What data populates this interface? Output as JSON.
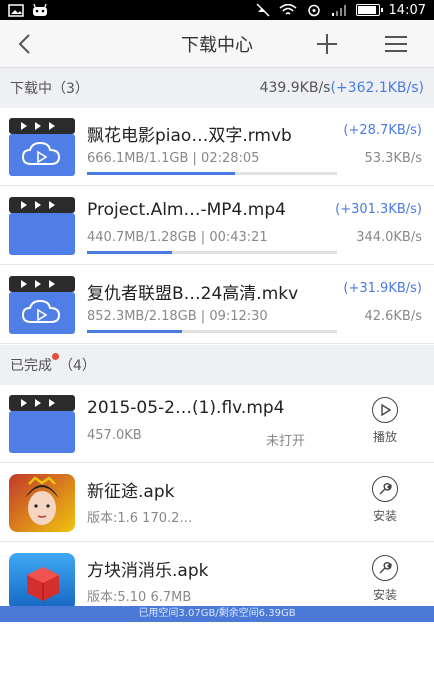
{
  "statusbar": {
    "time": "14:07"
  },
  "header": {
    "title": "下载中心"
  },
  "downloading": {
    "label": "下载中（3）",
    "total_speed": "439.9KB/s",
    "total_delta": "(+362.1KB/s)",
    "items": [
      {
        "name": "飘花电影piao…双字.rmvb",
        "delta": "(+28.7KB/s)",
        "meta": "666.1MB/1.1GB | 02:28:05",
        "rate": "53.3KB/s",
        "progress": 0.59,
        "thumb": "video-cloud"
      },
      {
        "name": "Project.Alm…-MP4.mp4",
        "delta": "(+301.3KB/s)",
        "meta": "440.7MB/1.28GB | 00:43:21",
        "rate": "344.0KB/s",
        "progress": 0.34,
        "thumb": "video-plain"
      },
      {
        "name": "复仇者联盟B…24高清.mkv",
        "delta": "(+31.9KB/s)",
        "meta": "852.3MB/2.18GB | 09:12:30",
        "rate": "42.6KB/s",
        "progress": 0.38,
        "thumb": "video-cloud"
      }
    ]
  },
  "completed": {
    "label": "已完成",
    "count": "（4）",
    "items": [
      {
        "name": "2015-05-2…(1).flv.mp4",
        "meta": "457.0KB",
        "status": "未打开",
        "action": "播放",
        "action_icon": "play-icon"
      },
      {
        "name": "新征途.apk",
        "meta": "版本:1.6    170.2…",
        "action": "安装",
        "action_icon": "wrench-icon"
      },
      {
        "name": "方块消消乐.apk",
        "meta": "版本:5.10    6.7MB",
        "action": "安装",
        "action_icon": "wrench-icon"
      }
    ]
  },
  "storage": {
    "text": "已用空间3.07GB/剩余空间6.39GB"
  },
  "colors": {
    "accent": "#4a7be0",
    "thumb_blue": "#4f7fe6",
    "thumb_dark": "#2b2b2b",
    "section_bg": "#eef0f4"
  }
}
